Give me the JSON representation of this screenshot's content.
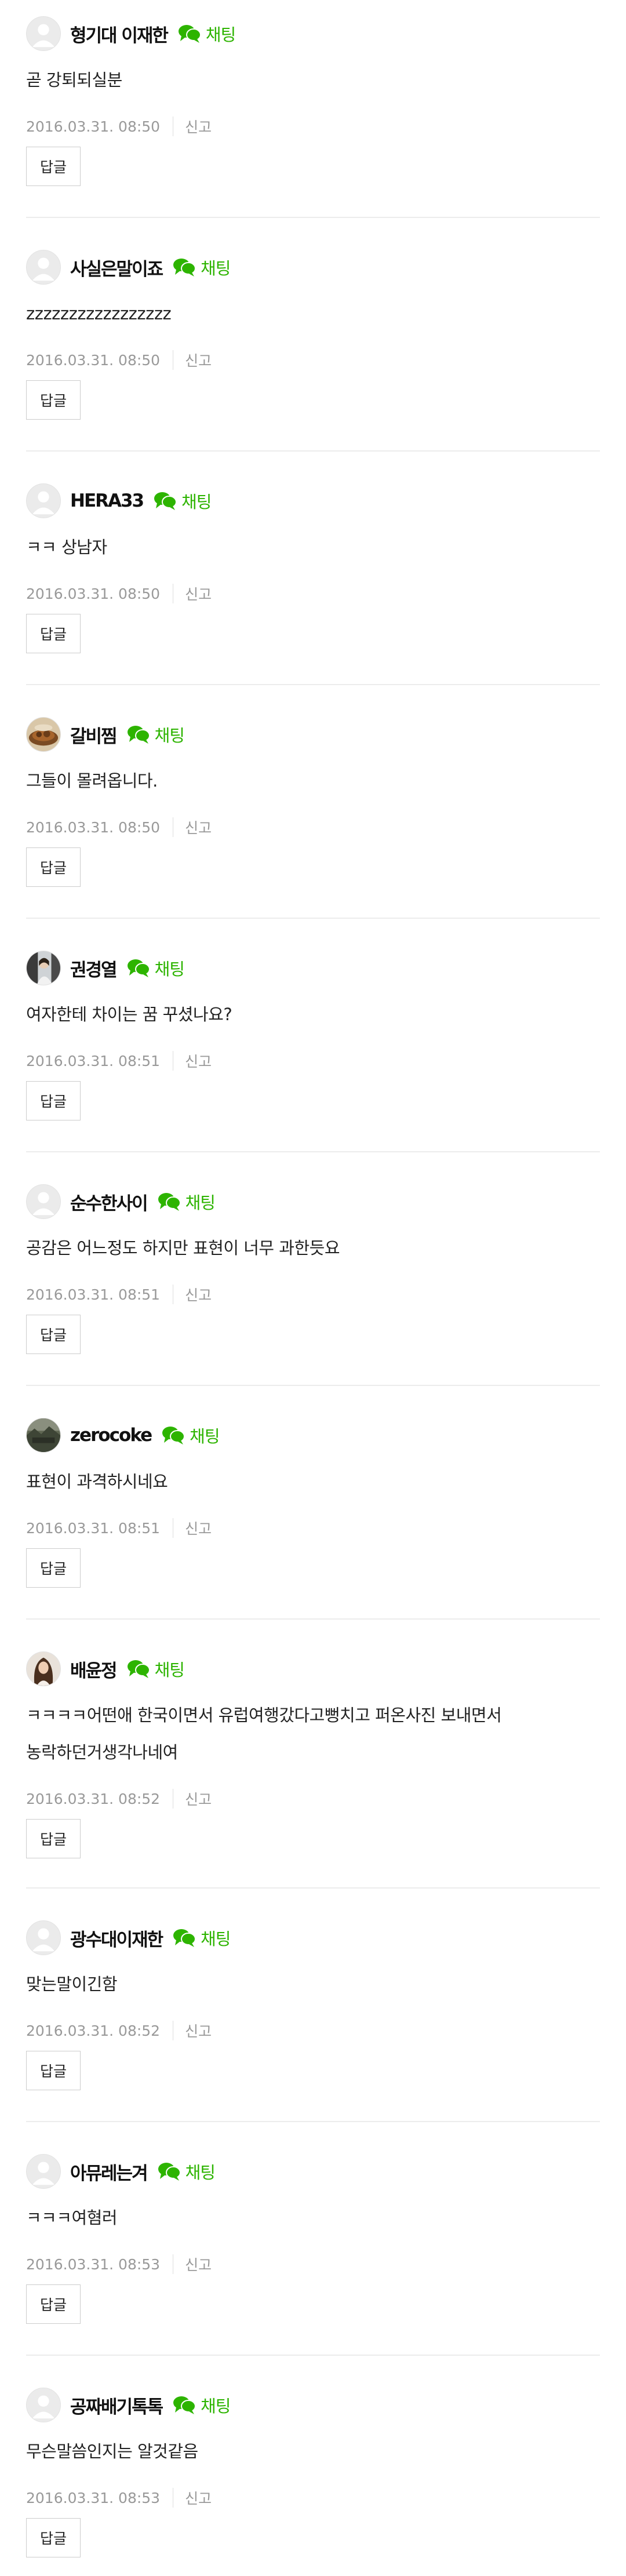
{
  "labels": {
    "chat": "채팅",
    "report": "신고",
    "reply": "답글"
  },
  "colors": {
    "accent_green": "#2db400",
    "meta_gray": "#999999",
    "divider": "#ececec"
  },
  "comments": [
    {
      "username": "형기대 이재한",
      "text": "곧 강퇴되실분",
      "date": "2016.03.31. 08:50",
      "avatar": "default-avatar-icon"
    },
    {
      "username": "사실은말이죠",
      "text": "zzzzzzzzzzzzzzzzz",
      "date": "2016.03.31. 08:50",
      "avatar": "default-avatar-icon"
    },
    {
      "username": "HERA33",
      "text": "ㅋㅋ 상남자",
      "date": "2016.03.31. 08:50",
      "avatar": "default-avatar-icon"
    },
    {
      "username": "갈비찜",
      "text": "그들이 몰려옵니다.",
      "date": "2016.03.31. 08:50",
      "avatar": "food-photo-avatar"
    },
    {
      "username": "권경열",
      "text": "여자한테 차이는 꿈 꾸셨나요?",
      "date": "2016.03.31. 08:51",
      "avatar": "person-photo-avatar"
    },
    {
      "username": "순수한사이",
      "text": "공감은 어느정도 하지만 표현이 너무 과한듯요",
      "date": "2016.03.31. 08:51",
      "avatar": "default-avatar-icon"
    },
    {
      "username": "zerocoke",
      "text": "표현이 과격하시네요",
      "date": "2016.03.31. 08:51",
      "avatar": "landscape-photo-avatar"
    },
    {
      "username": "배윤정",
      "text": "ㅋㅋㅋㅋ어떤애 한국이면서 유럽여행갔다고뻥치고 퍼온사진 보내면서 농락하던거생각나네여",
      "date": "2016.03.31. 08:52",
      "avatar": "woman-photo-avatar"
    },
    {
      "username": "광수대이재한",
      "text": "맞는말이긴함",
      "date": "2016.03.31. 08:52",
      "avatar": "default-avatar-icon"
    },
    {
      "username": "아뮤레는겨",
      "text": "ㅋㅋㅋ여혐러",
      "date": "2016.03.31. 08:53",
      "avatar": "default-avatar-icon"
    },
    {
      "username": "공짜배기톡톡",
      "text": "무슨말씀인지는 알것같음",
      "date": "2016.03.31. 08:53",
      "avatar": "default-avatar-icon"
    }
  ]
}
